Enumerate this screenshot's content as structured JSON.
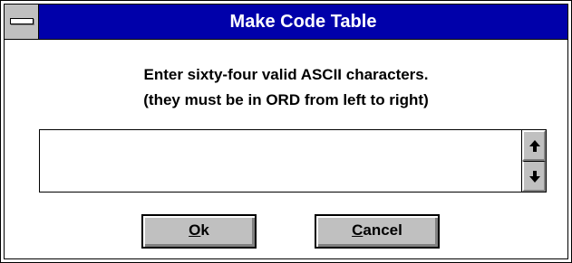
{
  "window": {
    "title": "Make Code Table",
    "system_menu_icon": "system-menu-icon",
    "title_bar_color": "#0000aa",
    "face_color": "#c0c0c0"
  },
  "prompt": {
    "line1": "Enter sixty-four valid ASCII characters.",
    "line2": "(they must be in ORD from left to right)"
  },
  "code_input": {
    "value": "",
    "placeholder": ""
  },
  "scrollbar": {
    "up_icon": "arrow-up-icon",
    "down_icon": "arrow-down-icon"
  },
  "buttons": {
    "ok": {
      "mnemonic": "O",
      "rest": "k"
    },
    "cancel": {
      "mnemonic": "C",
      "rest": "ancel"
    }
  }
}
